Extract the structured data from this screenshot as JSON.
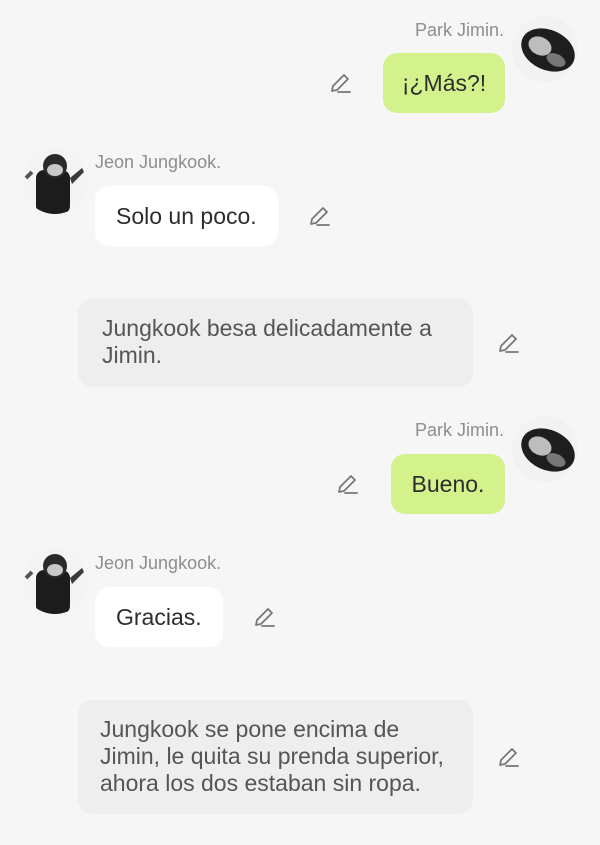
{
  "colors": {
    "background": "#f6f6f6",
    "outgoing_bubble": "#d4f28c",
    "incoming_bubble": "#ffffff",
    "narration_bubble": "#eeeeee",
    "name_text": "#8d8d8d"
  },
  "messages": [
    {
      "type": "outgoing",
      "sender": "Park Jimin.",
      "text": "¡¿Más?!",
      "avatar": "avatar-jimin",
      "edit_icon": "pencil-icon"
    },
    {
      "type": "incoming",
      "sender": "Jeon Jungkook.",
      "text": "Solo un poco.",
      "avatar": "avatar-jungkook",
      "edit_icon": "pencil-icon"
    },
    {
      "type": "narration",
      "text": "Jungkook besa delicadamente a Jimin.",
      "edit_icon": "pencil-icon"
    },
    {
      "type": "outgoing",
      "sender": "Park Jimin.",
      "text": "Bueno.",
      "avatar": "avatar-jimin",
      "edit_icon": "pencil-icon"
    },
    {
      "type": "incoming",
      "sender": "Jeon Jungkook.",
      "text": "Gracias.",
      "avatar": "avatar-jungkook",
      "edit_icon": "pencil-icon"
    },
    {
      "type": "narration",
      "text": "Jungkook se pone encima de Jimin, le quita su prenda superior, ahora los dos estaban sin ropa.",
      "edit_icon": "pencil-icon"
    }
  ]
}
